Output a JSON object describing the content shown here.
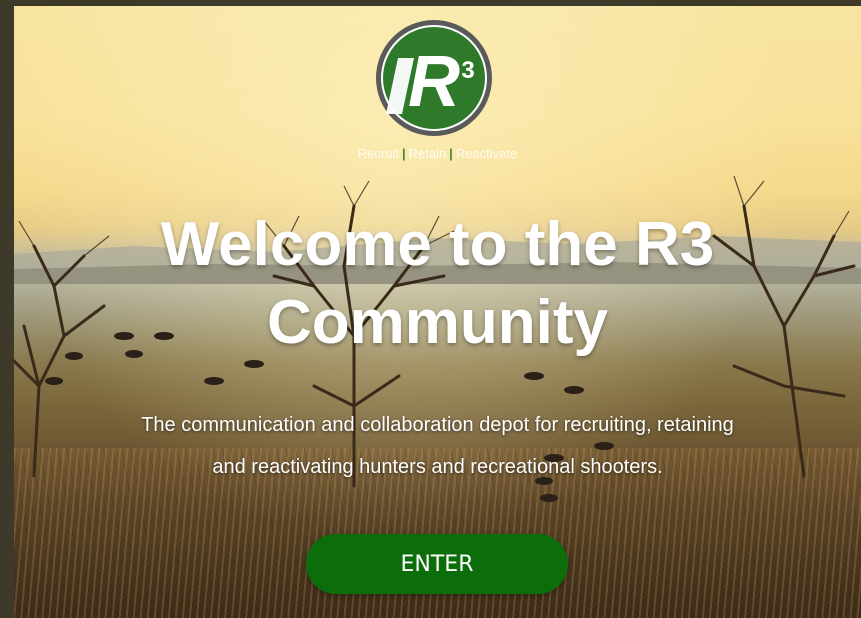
{
  "logo": {
    "letters": "R",
    "superscript": "3",
    "name": "r3-logo-icon"
  },
  "tagline": {
    "words": [
      "Recruit",
      "Retain",
      "Reactivate"
    ],
    "separator": "|"
  },
  "hero": {
    "title_line1": "Welcome to the R3",
    "title_line2": "Community",
    "subtitle_line1": "The communication and collaboration depot for recruiting, retaining",
    "subtitle_line2": "and reactivating hunters and recreational shooters."
  },
  "cta": {
    "label": "ENTER"
  },
  "colors": {
    "brand_green": "#0b6e0b",
    "logo_green": "#2f7a2a",
    "frame": "#3e3a2a"
  }
}
